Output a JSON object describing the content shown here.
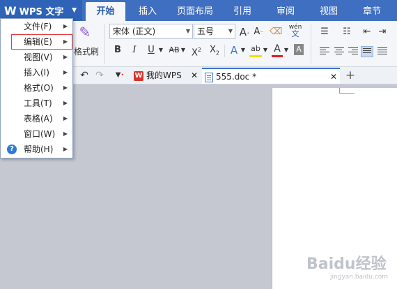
{
  "app": {
    "name": "WPS 文字",
    "logo": "W"
  },
  "ribbon_tabs": [
    "开始",
    "插入",
    "页面布局",
    "引用",
    "审阅",
    "视图",
    "章节"
  ],
  "ribbon": {
    "format_painter_label": "格式刷",
    "font_name": "宋体 (正文)",
    "font_size": "五号",
    "bold": "B",
    "italic": "I",
    "underline": "U",
    "strikethrough": "AB",
    "superscript": "X",
    "sup_mark": "2",
    "subscript": "X",
    "sub_mark": "2",
    "grow_font": "A",
    "shrink_font": "A",
    "font_color": "A",
    "text_effect": "A",
    "highlight": "ab",
    "pinyin": "wén",
    "pinyin_char": "文"
  },
  "doc_tabs": [
    {
      "label": "我的WPS",
      "icon": "wps-logo-icon",
      "active": false
    },
    {
      "label": "555.doc *",
      "icon": "document-icon",
      "active": true
    }
  ],
  "menu": {
    "items": [
      {
        "label": "文件(F)",
        "has_submenu": true
      },
      {
        "label": "编辑(E)",
        "has_submenu": true
      },
      {
        "label": "视图(V)",
        "has_submenu": true
      },
      {
        "label": "插入(I)",
        "has_submenu": true
      },
      {
        "label": "格式(O)",
        "has_submenu": true
      },
      {
        "label": "工具(T)",
        "has_submenu": true
      },
      {
        "label": "表格(A)",
        "has_submenu": true
      },
      {
        "label": "窗口(W)",
        "has_submenu": true
      },
      {
        "label": "帮助(H)",
        "has_submenu": true
      }
    ]
  },
  "watermark": {
    "text": "Baidu经验",
    "sub": "jingyan.baidu.com"
  },
  "colors": {
    "topbar": "#3f6fc0",
    "accent": "#2a5db0",
    "highlight_box": "#e03a3a"
  }
}
